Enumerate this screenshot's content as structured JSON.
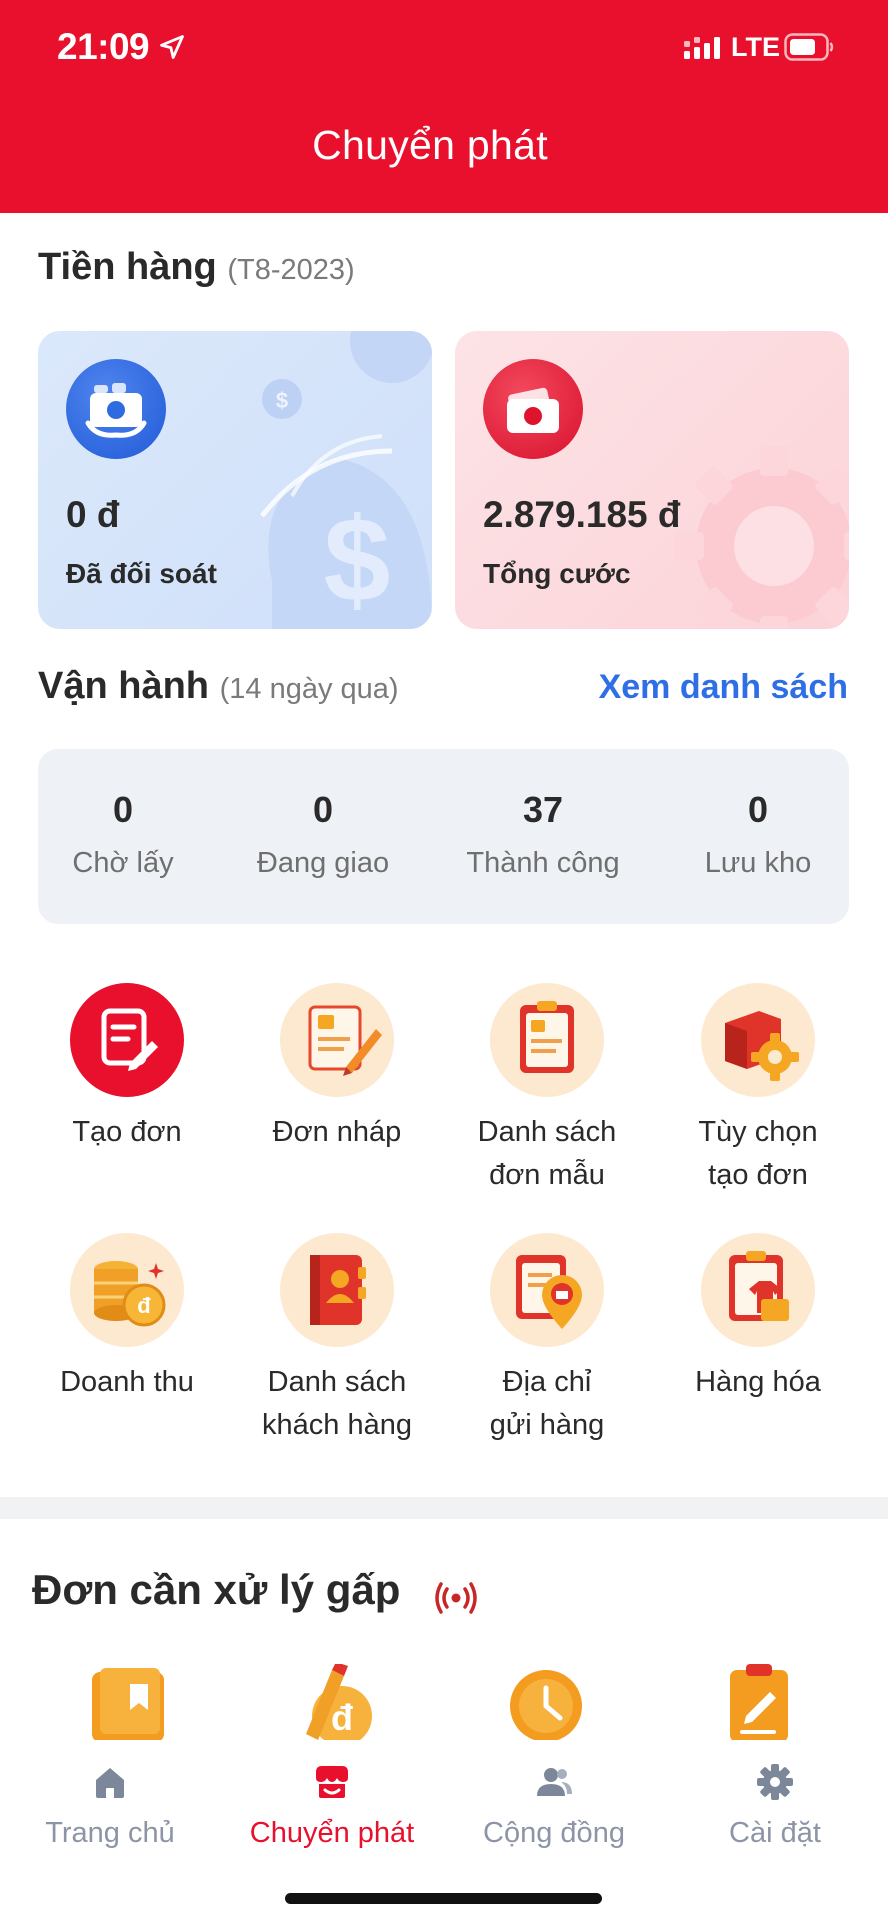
{
  "status_bar": {
    "time": "21:09",
    "network": "LTE"
  },
  "header": {
    "title": "Chuyển phát"
  },
  "revenue": {
    "title": "Tiền hàng",
    "period": "(T8-2023)",
    "cards": [
      {
        "value": "0 đ",
        "label": "Đã đối soát"
      },
      {
        "value": "2.879.185 đ",
        "label": "Tổng cước"
      }
    ]
  },
  "operations": {
    "title": "Vận hành",
    "period": "(14 ngày qua)",
    "link": "Xem danh sách",
    "stats": [
      {
        "value": "0",
        "label": "Chờ lấy"
      },
      {
        "value": "0",
        "label": "Đang giao"
      },
      {
        "value": "37",
        "label": "Thành công"
      },
      {
        "value": "0",
        "label": "Lưu kho"
      }
    ]
  },
  "actions": [
    {
      "line1": "Tạo đơn",
      "line2": ""
    },
    {
      "line1": "Đơn nháp",
      "line2": ""
    },
    {
      "line1": "Danh sách",
      "line2": "đơn mẫu"
    },
    {
      "line1": "Tùy chọn",
      "line2": "tạo đơn"
    },
    {
      "line1": "Doanh thu",
      "line2": ""
    },
    {
      "line1": "Danh sách",
      "line2": "khách hàng"
    },
    {
      "line1": "Địa chỉ",
      "line2": "gửi hàng"
    },
    {
      "line1": "Hàng hóa",
      "line2": ""
    }
  ],
  "urgent": {
    "title": "Đơn cần xử lý gấp"
  },
  "tabbar": {
    "tabs": [
      {
        "label": "Trang chủ",
        "icon": "home-icon"
      },
      {
        "label": "Chuyển phát",
        "icon": "shop-icon"
      },
      {
        "label": "Cộng đồng",
        "icon": "community-icon"
      },
      {
        "label": "Cài đặt",
        "icon": "gear-icon"
      }
    ],
    "active": "Chuyển phát"
  },
  "colors": {
    "brand_red": "#e8102c",
    "link_blue": "#2f6fe6",
    "card_blue": "#d6e5fa",
    "card_pink": "#fcdde1"
  }
}
